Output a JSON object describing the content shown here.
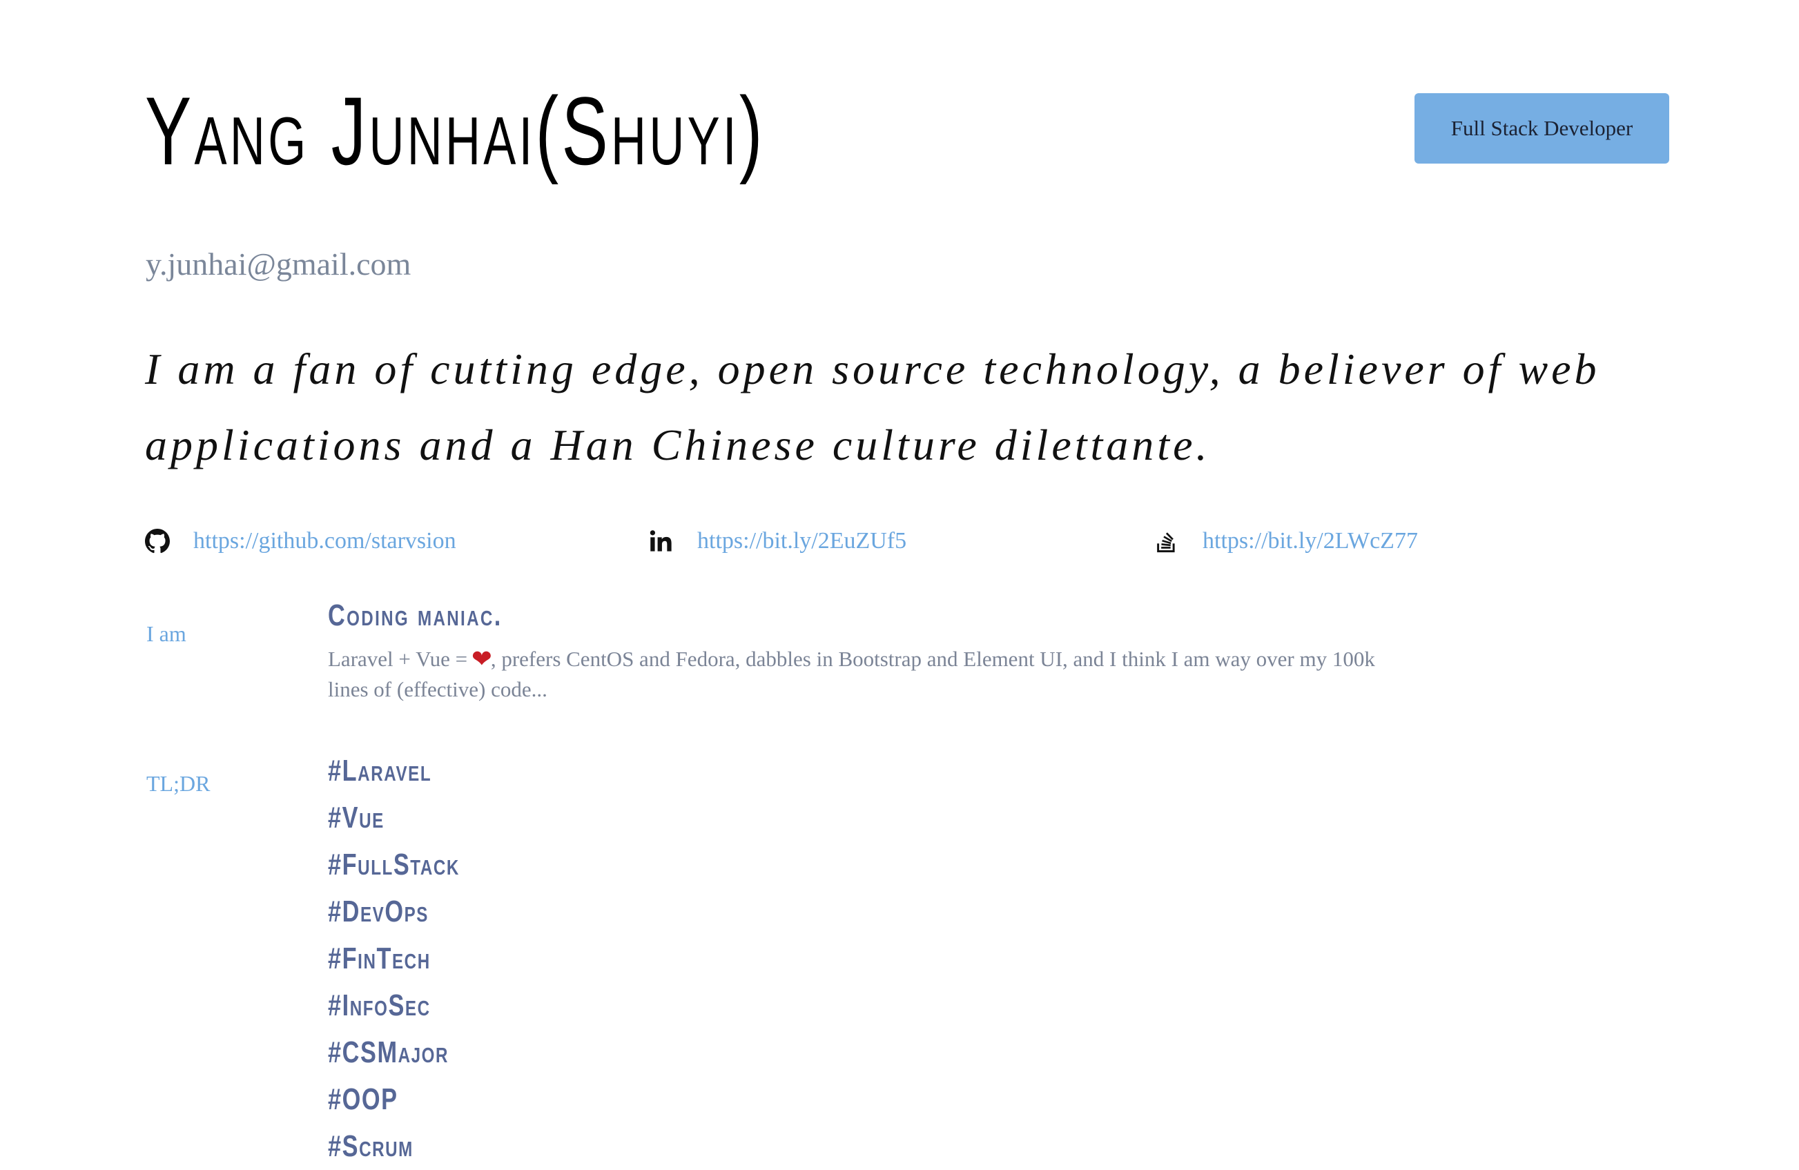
{
  "header": {
    "name": "Yang Junhai(Shuyi)",
    "role_button": "Full Stack Developer",
    "email": "y.junhai@gmail.com"
  },
  "tagline": "I am a fan of cutting edge, open source technology, a believer of web applications and a Han Chinese culture dilettante.",
  "social": [
    {
      "icon": "github-icon",
      "url": "https://github.com/starvsion"
    },
    {
      "icon": "linkedin-icon",
      "url": "https://bit.ly/2EuZUf5"
    },
    {
      "icon": "stackoverflow-icon",
      "url": "https://bit.ly/2LWcZ77"
    }
  ],
  "sections": {
    "iam": {
      "label": "I am",
      "title": "Coding maniac.",
      "desc_part1": "Laravel + Vue = ",
      "heart": "❤",
      "desc_part2": ", prefers CentOS and Fedora, dabbles in Bootstrap and Element UI, and I think I am way over my 100k lines of (effective) code..."
    },
    "tldr": {
      "label": "TL;DR",
      "tags": [
        "#Laravel",
        "#Vue",
        "#FullStack",
        "#DevOps",
        "#FinTech",
        "#InfoSec",
        "#CSMajor",
        "#OOP",
        "#Scrum"
      ]
    }
  },
  "colors": {
    "accent": "#76aee3",
    "link": "#6aa6df",
    "muted": "#7a8699",
    "tag": "#566796",
    "heart": "#c81d25"
  }
}
